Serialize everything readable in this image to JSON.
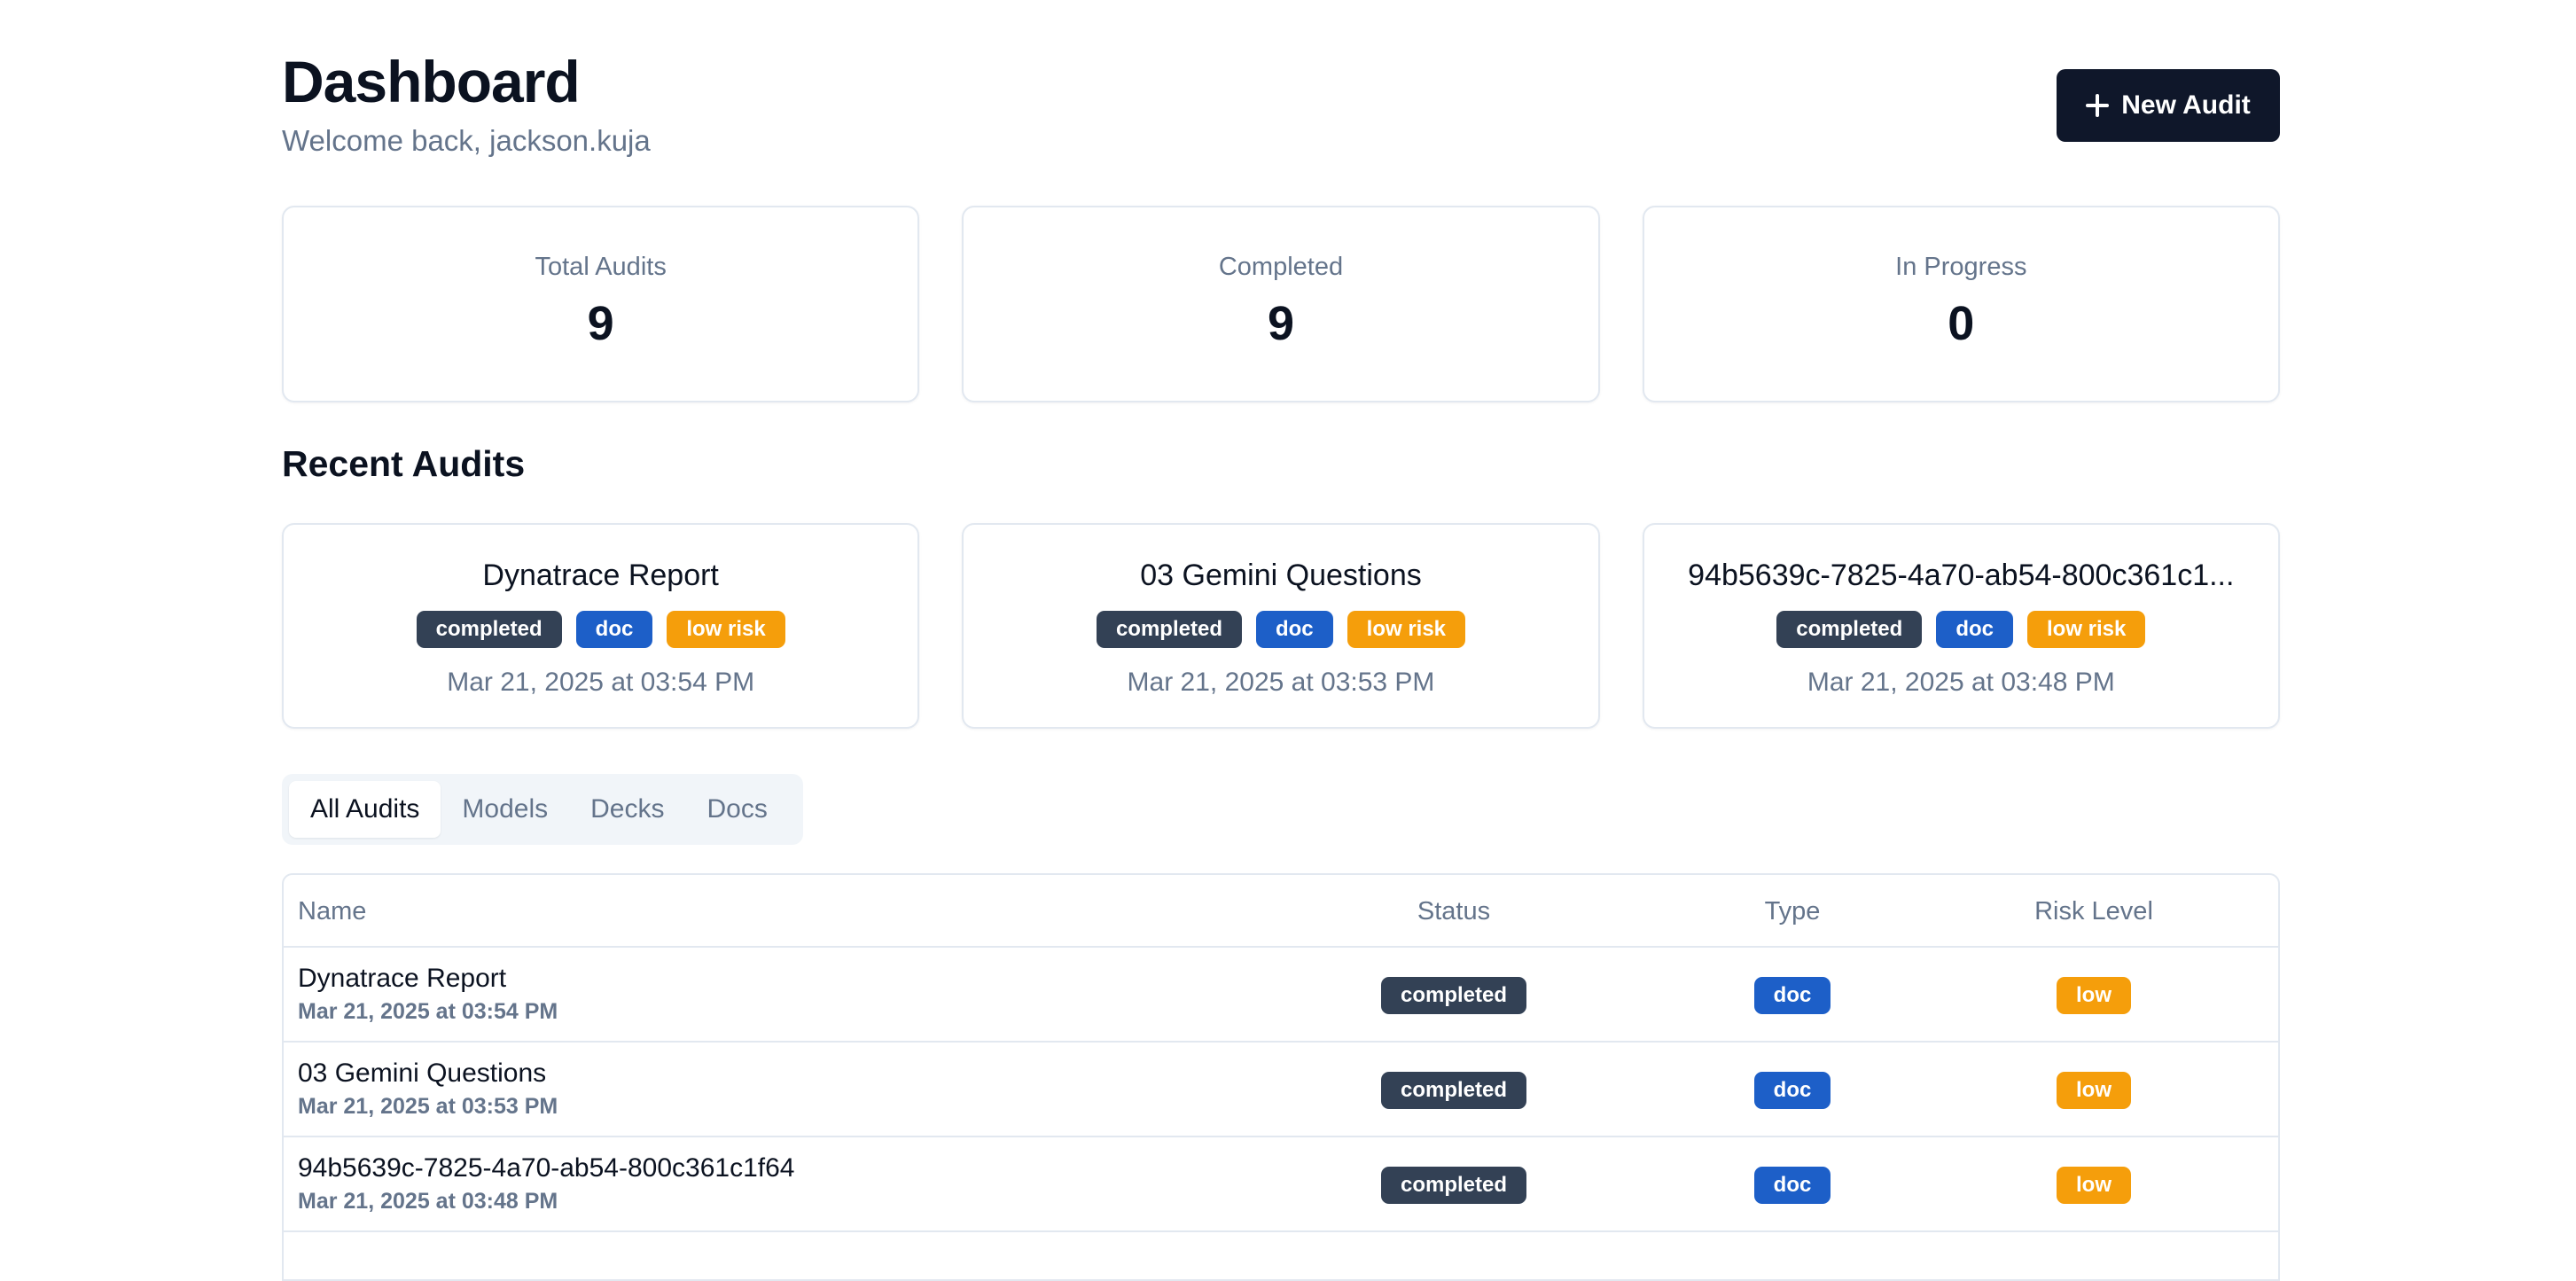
{
  "header": {
    "title": "Dashboard",
    "subtitle": "Welcome back, jackson.kuja",
    "new_audit_label": "New Audit"
  },
  "stats": [
    {
      "label": "Total Audits",
      "value": "9"
    },
    {
      "label": "Completed",
      "value": "9"
    },
    {
      "label": "In Progress",
      "value": "0"
    }
  ],
  "recent": {
    "title": "Recent Audits",
    "items": [
      {
        "name": "Dynatrace Report",
        "status": "completed",
        "type": "doc",
        "risk": "low risk",
        "date": "Mar 21, 2025 at 03:54 PM"
      },
      {
        "name": "03 Gemini Questions",
        "status": "completed",
        "type": "doc",
        "risk": "low risk",
        "date": "Mar 21, 2025 at 03:53 PM"
      },
      {
        "name": "94b5639c-7825-4a70-ab54-800c361c1...",
        "status": "completed",
        "type": "doc",
        "risk": "low risk",
        "date": "Mar 21, 2025 at 03:48 PM"
      }
    ]
  },
  "tabs": [
    {
      "label": "All Audits",
      "active": true
    },
    {
      "label": "Models",
      "active": false
    },
    {
      "label": "Decks",
      "active": false
    },
    {
      "label": "Docs",
      "active": false
    }
  ],
  "table": {
    "headers": {
      "name": "Name",
      "status": "Status",
      "type": "Type",
      "risk": "Risk Level"
    },
    "rows": [
      {
        "name": "Dynatrace Report",
        "date": "Mar 21, 2025 at 03:54 PM",
        "status": "completed",
        "type": "doc",
        "risk": "low"
      },
      {
        "name": "03 Gemini Questions",
        "date": "Mar 21, 2025 at 03:53 PM",
        "status": "completed",
        "type": "doc",
        "risk": "low"
      },
      {
        "name": "94b5639c-7825-4a70-ab54-800c361c1f64",
        "date": "Mar 21, 2025 at 03:48 PM",
        "status": "completed",
        "type": "doc",
        "risk": "low"
      }
    ]
  },
  "colors": {
    "primary": "#0f172a",
    "status_badge": "#334155",
    "type_badge": "#1d5fc8",
    "risk_badge": "#f59e0b",
    "muted_text": "#64748b",
    "border": "#e2e8f0"
  }
}
